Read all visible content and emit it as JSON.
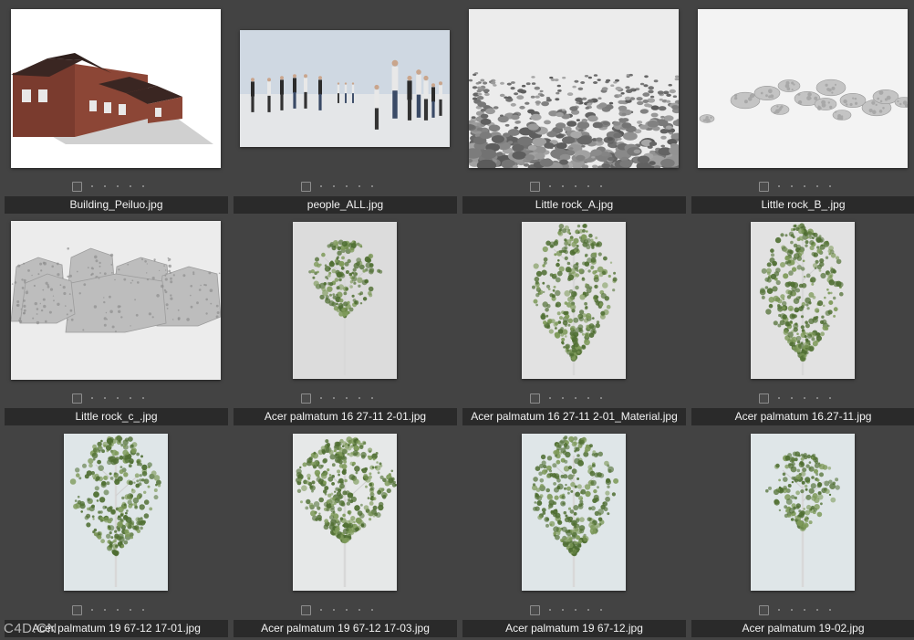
{
  "browser": {
    "items": [
      {
        "filename": "Building_Peiluo.jpg",
        "kind": "building",
        "shape": "land",
        "bg": "#ffffff"
      },
      {
        "filename": "people_ALL.jpg",
        "kind": "people",
        "shape": "wide",
        "bg": "#d8dde3"
      },
      {
        "filename": "Little rock_A.jpg",
        "kind": "rock-field",
        "shape": "land",
        "bg": "#ececec"
      },
      {
        "filename": "Little rock_B_.jpg",
        "kind": "pebbles",
        "shape": "land",
        "bg": "#f3f3f3"
      },
      {
        "filename": "Little rock_c_.jpg",
        "kind": "boulders",
        "shape": "land",
        "bg": "#ececec"
      },
      {
        "filename": "Acer palmatum 16 27-11 2-01.jpg",
        "kind": "tree-sparse",
        "shape": "port",
        "bg": "#dcdcdc"
      },
      {
        "filename": "Acer palmatum 16 27-11 2-01_Material.jpg",
        "kind": "tree-tall",
        "shape": "port",
        "bg": "#e2e2e2"
      },
      {
        "filename": "Acer palmatum 16.27-11.jpg",
        "kind": "tree-tall",
        "shape": "port",
        "bg": "#e2e2e2"
      },
      {
        "filename": "Acer palmatum 19 67-12 17-01.jpg",
        "kind": "tree-mid",
        "shape": "port",
        "bg": "#dfe6e8"
      },
      {
        "filename": "Acer palmatum 19 67-12 17-03.jpg",
        "kind": "tree-broad",
        "shape": "port",
        "bg": "#e6e8e8"
      },
      {
        "filename": "Acer palmatum 19 67-12.jpg",
        "kind": "tree-mid",
        "shape": "port",
        "bg": "#dfe6e8"
      },
      {
        "filename": "Acer palmatum 19-02.jpg",
        "kind": "tree-sparse",
        "shape": "port",
        "bg": "#dfe6e8"
      }
    ]
  },
  "watermark": "C4D.CN",
  "colors": {
    "background": "#434343",
    "label_bar": "#2a2a2a",
    "label_text": "#f2f2f2",
    "foliage": "#4f6e32",
    "foliage_light": "#7e9a5a"
  }
}
